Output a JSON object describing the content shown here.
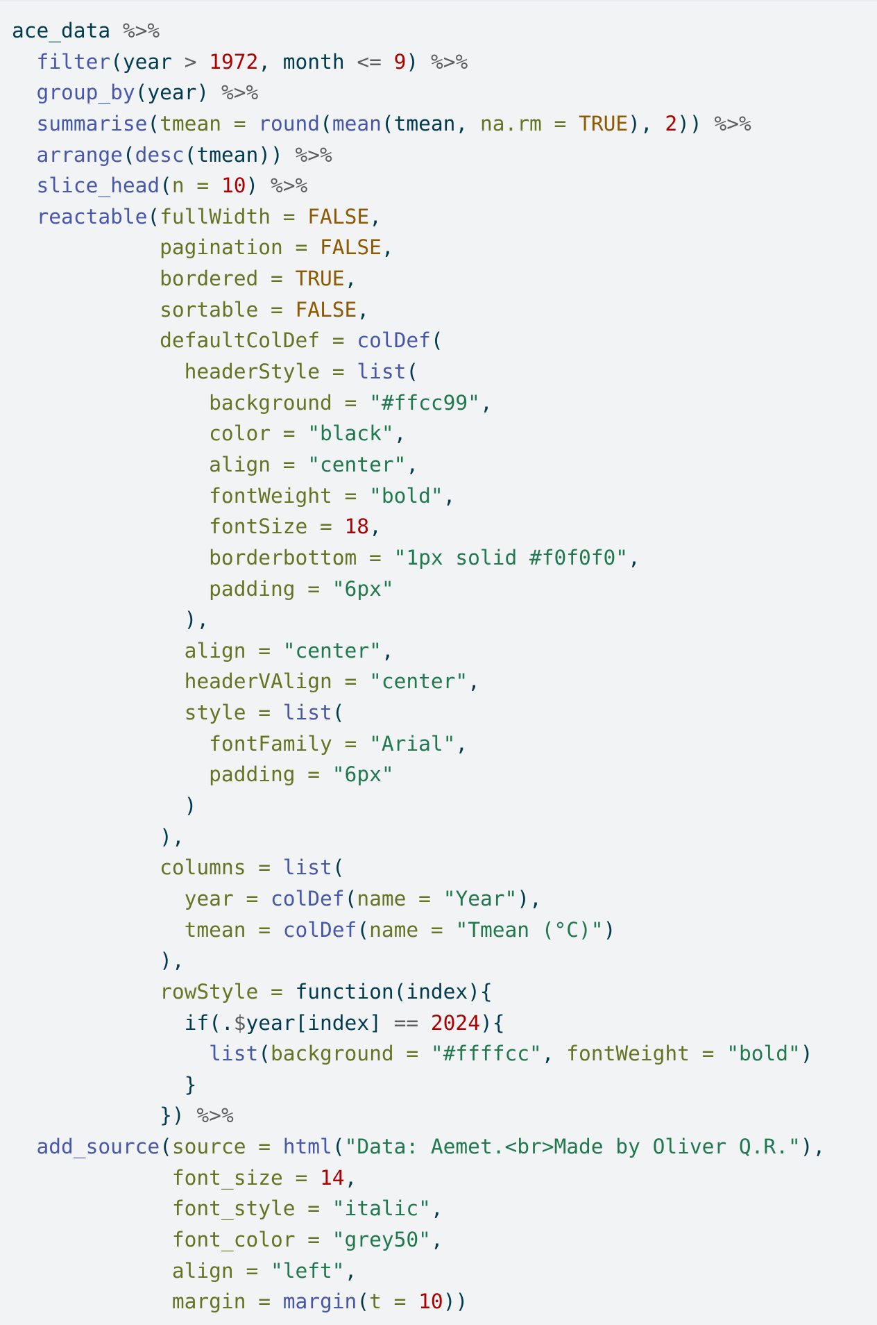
{
  "document": {
    "language": "R",
    "colors": {
      "background": "#f1f3f5",
      "plain": "#003b4f",
      "function": "#4758ab",
      "argument": "#657422",
      "number": "#ad0000",
      "boolean": "#8f5902",
      "string": "#20794d",
      "operator": "#5e5e5e"
    },
    "lines": [
      [
        [
          "plain",
          "ace_data "
        ],
        [
          "op",
          "%>%"
        ]
      ],
      [
        [
          "plain",
          "  "
        ],
        [
          "fn",
          "filter"
        ],
        [
          "plain",
          "(year "
        ],
        [
          "op",
          ">"
        ],
        [
          "plain",
          " "
        ],
        [
          "num",
          "1972"
        ],
        [
          "plain",
          ", month "
        ],
        [
          "op",
          "<="
        ],
        [
          "plain",
          " "
        ],
        [
          "num",
          "9"
        ],
        [
          "plain",
          ") "
        ],
        [
          "op",
          "%>%"
        ]
      ],
      [
        [
          "plain",
          "  "
        ],
        [
          "fn",
          "group_by"
        ],
        [
          "plain",
          "(year) "
        ],
        [
          "op",
          "%>%"
        ]
      ],
      [
        [
          "plain",
          "  "
        ],
        [
          "fn",
          "summarise"
        ],
        [
          "plain",
          "("
        ],
        [
          "arg",
          "tmean ="
        ],
        [
          "plain",
          " "
        ],
        [
          "fn",
          "round"
        ],
        [
          "plain",
          "("
        ],
        [
          "fn",
          "mean"
        ],
        [
          "plain",
          "(tmean, "
        ],
        [
          "arg",
          "na.rm ="
        ],
        [
          "plain",
          " "
        ],
        [
          "bool",
          "TRUE"
        ],
        [
          "plain",
          "), "
        ],
        [
          "num",
          "2"
        ],
        [
          "plain",
          ")) "
        ],
        [
          "op",
          "%>%"
        ]
      ],
      [
        [
          "plain",
          "  "
        ],
        [
          "fn",
          "arrange"
        ],
        [
          "plain",
          "("
        ],
        [
          "fn",
          "desc"
        ],
        [
          "plain",
          "(tmean)) "
        ],
        [
          "op",
          "%>%"
        ]
      ],
      [
        [
          "plain",
          "  "
        ],
        [
          "fn",
          "slice_head"
        ],
        [
          "plain",
          "("
        ],
        [
          "arg",
          "n ="
        ],
        [
          "plain",
          " "
        ],
        [
          "num",
          "10"
        ],
        [
          "plain",
          ") "
        ],
        [
          "op",
          "%>%"
        ]
      ],
      [
        [
          "plain",
          "  "
        ],
        [
          "fn",
          "reactable"
        ],
        [
          "plain",
          "("
        ],
        [
          "arg",
          "fullWidth ="
        ],
        [
          "plain",
          " "
        ],
        [
          "bool",
          "FALSE"
        ],
        [
          "plain",
          ","
        ]
      ],
      [
        [
          "plain",
          "            "
        ],
        [
          "arg",
          "pagination ="
        ],
        [
          "plain",
          " "
        ],
        [
          "bool",
          "FALSE"
        ],
        [
          "plain",
          ","
        ]
      ],
      [
        [
          "plain",
          "            "
        ],
        [
          "arg",
          "bordered ="
        ],
        [
          "plain",
          " "
        ],
        [
          "bool",
          "TRUE"
        ],
        [
          "plain",
          ","
        ]
      ],
      [
        [
          "plain",
          "            "
        ],
        [
          "arg",
          "sortable ="
        ],
        [
          "plain",
          " "
        ],
        [
          "bool",
          "FALSE"
        ],
        [
          "plain",
          ","
        ]
      ],
      [
        [
          "plain",
          "            "
        ],
        [
          "arg",
          "defaultColDef ="
        ],
        [
          "plain",
          " "
        ],
        [
          "fn",
          "colDef"
        ],
        [
          "plain",
          "("
        ]
      ],
      [
        [
          "plain",
          "              "
        ],
        [
          "arg",
          "headerStyle ="
        ],
        [
          "plain",
          " "
        ],
        [
          "fn",
          "list"
        ],
        [
          "plain",
          "("
        ]
      ],
      [
        [
          "plain",
          "                "
        ],
        [
          "arg",
          "background ="
        ],
        [
          "plain",
          " "
        ],
        [
          "str",
          "\"#ffcc99\""
        ],
        [
          "plain",
          ","
        ]
      ],
      [
        [
          "plain",
          "                "
        ],
        [
          "arg",
          "color ="
        ],
        [
          "plain",
          " "
        ],
        [
          "str",
          "\"black\""
        ],
        [
          "plain",
          ","
        ]
      ],
      [
        [
          "plain",
          "                "
        ],
        [
          "arg",
          "align ="
        ],
        [
          "plain",
          " "
        ],
        [
          "str",
          "\"center\""
        ],
        [
          "plain",
          ","
        ]
      ],
      [
        [
          "plain",
          "                "
        ],
        [
          "arg",
          "fontWeight ="
        ],
        [
          "plain",
          " "
        ],
        [
          "str",
          "\"bold\""
        ],
        [
          "plain",
          ","
        ]
      ],
      [
        [
          "plain",
          "                "
        ],
        [
          "arg",
          "fontSize ="
        ],
        [
          "plain",
          " "
        ],
        [
          "num",
          "18"
        ],
        [
          "plain",
          ","
        ]
      ],
      [
        [
          "plain",
          "                "
        ],
        [
          "arg",
          "borderbottom ="
        ],
        [
          "plain",
          " "
        ],
        [
          "str",
          "\"1px solid #f0f0f0\""
        ],
        [
          "plain",
          ","
        ]
      ],
      [
        [
          "plain",
          "                "
        ],
        [
          "arg",
          "padding ="
        ],
        [
          "plain",
          " "
        ],
        [
          "str",
          "\"6px\""
        ]
      ],
      [
        [
          "plain",
          "              ),"
        ]
      ],
      [
        [
          "plain",
          "              "
        ],
        [
          "arg",
          "align ="
        ],
        [
          "plain",
          " "
        ],
        [
          "str",
          "\"center\""
        ],
        [
          "plain",
          ","
        ]
      ],
      [
        [
          "plain",
          "              "
        ],
        [
          "arg",
          "headerVAlign ="
        ],
        [
          "plain",
          " "
        ],
        [
          "str",
          "\"center\""
        ],
        [
          "plain",
          ","
        ]
      ],
      [
        [
          "plain",
          "              "
        ],
        [
          "arg",
          "style ="
        ],
        [
          "plain",
          " "
        ],
        [
          "fn",
          "list"
        ],
        [
          "plain",
          "("
        ]
      ],
      [
        [
          "plain",
          "                "
        ],
        [
          "arg",
          "fontFamily ="
        ],
        [
          "plain",
          " "
        ],
        [
          "str",
          "\"Arial\""
        ],
        [
          "plain",
          ","
        ]
      ],
      [
        [
          "plain",
          "                "
        ],
        [
          "arg",
          "padding ="
        ],
        [
          "plain",
          " "
        ],
        [
          "str",
          "\"6px\""
        ]
      ],
      [
        [
          "plain",
          "              )"
        ]
      ],
      [
        [
          "plain",
          "            ),"
        ]
      ],
      [
        [
          "plain",
          "            "
        ],
        [
          "arg",
          "columns ="
        ],
        [
          "plain",
          " "
        ],
        [
          "fn",
          "list"
        ],
        [
          "plain",
          "("
        ]
      ],
      [
        [
          "plain",
          "              "
        ],
        [
          "arg",
          "year ="
        ],
        [
          "plain",
          " "
        ],
        [
          "fn",
          "colDef"
        ],
        [
          "plain",
          "("
        ],
        [
          "arg",
          "name ="
        ],
        [
          "plain",
          " "
        ],
        [
          "str",
          "\"Year\""
        ],
        [
          "plain",
          "),"
        ]
      ],
      [
        [
          "plain",
          "              "
        ],
        [
          "arg",
          "tmean ="
        ],
        [
          "plain",
          " "
        ],
        [
          "fn",
          "colDef"
        ],
        [
          "plain",
          "("
        ],
        [
          "arg",
          "name ="
        ],
        [
          "plain",
          " "
        ],
        [
          "str",
          "\"Tmean (°C)\""
        ],
        [
          "plain",
          ")"
        ]
      ],
      [
        [
          "plain",
          "            ),"
        ]
      ],
      [
        [
          "plain",
          "            "
        ],
        [
          "arg",
          "rowStyle ="
        ],
        [
          "plain",
          " function(index){"
        ]
      ],
      [
        [
          "plain",
          "              if(."
        ],
        [
          "op",
          "$"
        ],
        [
          "plain",
          "year[index] "
        ],
        [
          "op",
          "=="
        ],
        [
          "plain",
          " "
        ],
        [
          "num",
          "2024"
        ],
        [
          "plain",
          "){"
        ]
      ],
      [
        [
          "plain",
          "                "
        ],
        [
          "fn",
          "list"
        ],
        [
          "plain",
          "("
        ],
        [
          "arg",
          "background ="
        ],
        [
          "plain",
          " "
        ],
        [
          "str",
          "\"#ffffcc\""
        ],
        [
          "plain",
          ", "
        ],
        [
          "arg",
          "fontWeight ="
        ],
        [
          "plain",
          " "
        ],
        [
          "str",
          "\"bold\""
        ],
        [
          "plain",
          ")"
        ]
      ],
      [
        [
          "plain",
          "              }"
        ]
      ],
      [
        [
          "plain",
          "            }) "
        ],
        [
          "op",
          "%>%"
        ]
      ],
      [
        [
          "plain",
          "  "
        ],
        [
          "fn",
          "add_source"
        ],
        [
          "plain",
          "("
        ],
        [
          "arg",
          "source ="
        ],
        [
          "plain",
          " "
        ],
        [
          "fn",
          "html"
        ],
        [
          "plain",
          "("
        ],
        [
          "str",
          "\"Data: Aemet.<br>Made by Oliver Q.R.\""
        ],
        [
          "plain",
          "),"
        ]
      ],
      [
        [
          "plain",
          "             "
        ],
        [
          "arg",
          "font_size ="
        ],
        [
          "plain",
          " "
        ],
        [
          "num",
          "14"
        ],
        [
          "plain",
          ","
        ]
      ],
      [
        [
          "plain",
          "             "
        ],
        [
          "arg",
          "font_style ="
        ],
        [
          "plain",
          " "
        ],
        [
          "str",
          "\"italic\""
        ],
        [
          "plain",
          ","
        ]
      ],
      [
        [
          "plain",
          "             "
        ],
        [
          "arg",
          "font_color ="
        ],
        [
          "plain",
          " "
        ],
        [
          "str",
          "\"grey50\""
        ],
        [
          "plain",
          ","
        ]
      ],
      [
        [
          "plain",
          "             "
        ],
        [
          "arg",
          "align ="
        ],
        [
          "plain",
          " "
        ],
        [
          "str",
          "\"left\""
        ],
        [
          "plain",
          ","
        ]
      ],
      [
        [
          "plain",
          "             "
        ],
        [
          "arg",
          "margin ="
        ],
        [
          "plain",
          " "
        ],
        [
          "fn",
          "margin"
        ],
        [
          "plain",
          "("
        ],
        [
          "arg",
          "t ="
        ],
        [
          "plain",
          " "
        ],
        [
          "num",
          "10"
        ],
        [
          "plain",
          "))"
        ]
      ]
    ]
  }
}
